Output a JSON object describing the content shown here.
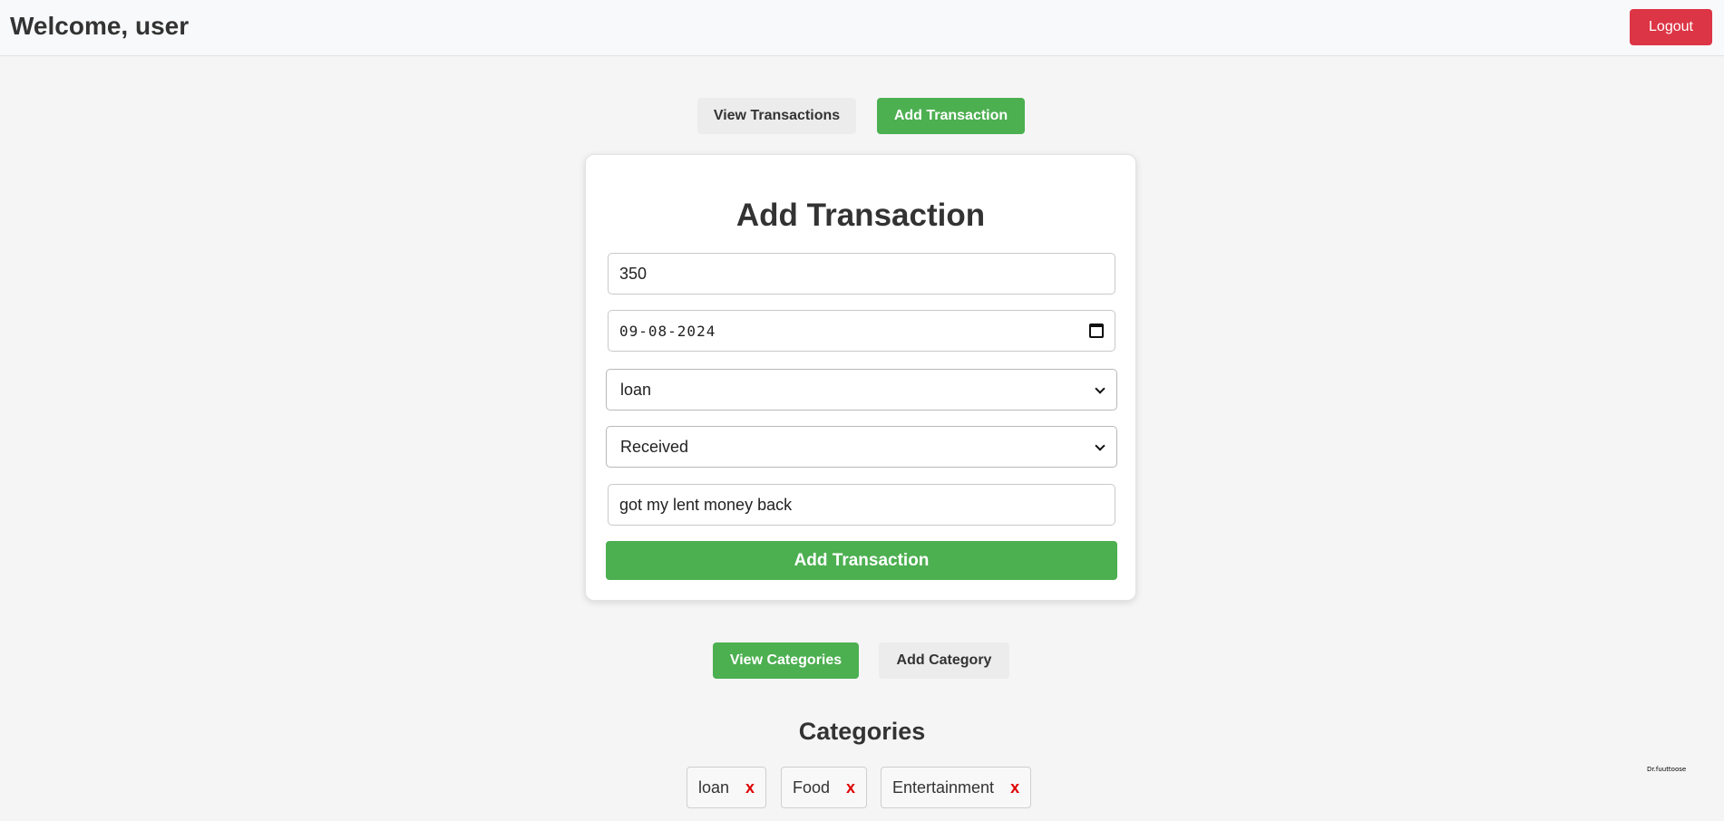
{
  "header": {
    "welcome": "Welcome, user",
    "logout_label": "Logout"
  },
  "transaction_tabs": {
    "view_label": "View Transactions",
    "add_label": "Add Transaction",
    "active": "add"
  },
  "form": {
    "title": "Add Transaction",
    "amount_value": "350",
    "date_value": "09-08-2024",
    "category_selected": "loan",
    "type_selected": "Received",
    "description_value": "got my lent money back",
    "submit_label": "Add Transaction"
  },
  "category_tabs": {
    "view_label": "View Categories",
    "add_label": "Add Category",
    "active": "view"
  },
  "categories": {
    "title": "Categories",
    "items": [
      {
        "name": "loan",
        "remove_label": "x"
      },
      {
        "name": "Food",
        "remove_label": "x"
      },
      {
        "name": "Entertainment",
        "remove_label": "x"
      }
    ]
  },
  "corner_text": "Dr.fuuttoose",
  "colors": {
    "accent": "#4caf50",
    "danger": "#dc3545",
    "remove": "#e00000"
  }
}
